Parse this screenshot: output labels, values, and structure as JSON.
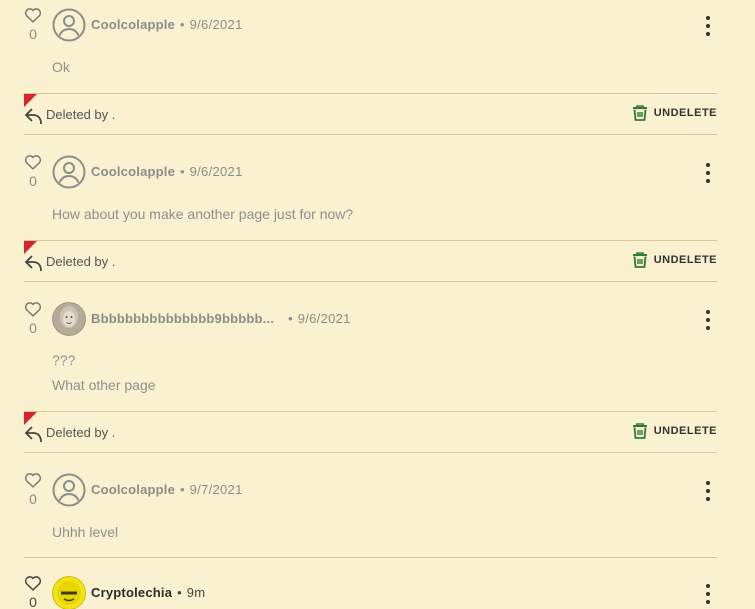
{
  "comments": [
    {
      "likes": "0",
      "author": "Coolcolapple",
      "separator": "•",
      "date": "9/6/2021",
      "lines": [
        "Ok"
      ],
      "deleted_label": "Deleted by .",
      "undelete_label": "UNDELETE"
    },
    {
      "likes": "0",
      "author": "Coolcolapple",
      "separator": "•",
      "date": "9/6/2021",
      "lines": [
        "How about you make another page just for now?"
      ],
      "deleted_label": "Deleted by .",
      "undelete_label": "UNDELETE"
    },
    {
      "likes": "0",
      "author": "Bbbbbbbbbbbbbbb9bbbbb...",
      "separator": "•",
      "date": "9/6/2021",
      "lines": [
        "???",
        "What other page"
      ],
      "deleted_label": "Deleted by .",
      "undelete_label": "UNDELETE"
    },
    {
      "likes": "0",
      "author": "Coolcolapple",
      "separator": "•",
      "date": "9/7/2021",
      "lines": [
        "Uhhh level"
      ]
    },
    {
      "likes": "0",
      "author": "Cryptolechia",
      "separator": "•",
      "date": "9m"
    }
  ],
  "colors": {
    "background": "#faf1d0",
    "deleted_flag": "#d8242a",
    "undelete_icon": "#2e7d32",
    "muted_text": "#8f8f8f"
  },
  "icons": {
    "like": "heart-outline-icon",
    "reply": "reply-arrow-icon",
    "undelete": "restore-bin-icon",
    "menu": "vertical-dots-icon"
  }
}
